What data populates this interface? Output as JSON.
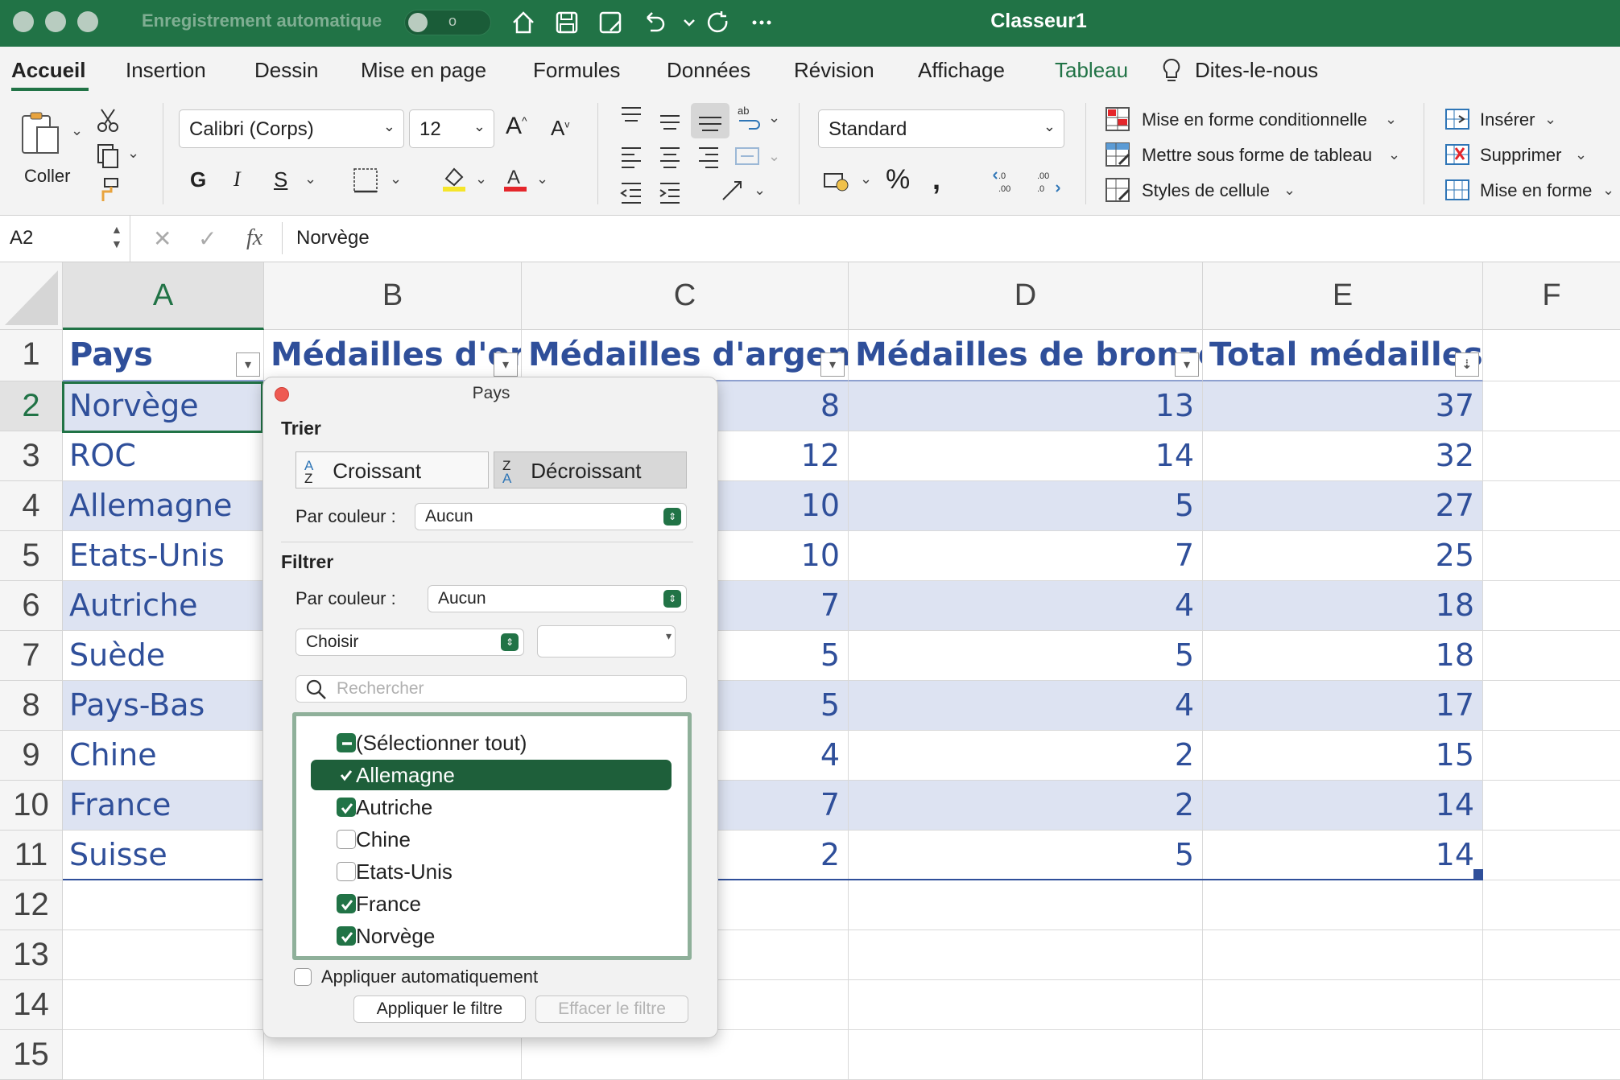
{
  "titlebar": {
    "autosave_label": "Enregistrement automatique",
    "autosave_state": "o",
    "window_title": "Classeur1",
    "icons": [
      "home-icon",
      "save-icon",
      "save-as-icon",
      "undo-icon",
      "chevron-down-icon",
      "redo-icon",
      "more-icon"
    ]
  },
  "tabs": [
    "Accueil",
    "Insertion",
    "Dessin",
    "Mise en page",
    "Formules",
    "Données",
    "Révision",
    "Affichage",
    "Tableau",
    "Dites-le-nous"
  ],
  "ribbon": {
    "paste_label": "Coller",
    "font_name": "Calibri (Corps)",
    "font_size": "12",
    "bold": "G",
    "italic": "I",
    "underline": "S",
    "number_format": "Standard",
    "styles": {
      "conditional": "Mise en forme conditionnelle",
      "table": "Mettre sous forme de tableau",
      "cell": "Styles de cellule"
    },
    "cells": {
      "insert": "Insérer",
      "delete": "Supprimer",
      "format": "Mise en forme"
    }
  },
  "formula_bar": {
    "name_box": "A2",
    "fx": "fx",
    "content": "Norvège"
  },
  "grid": {
    "column_letters": [
      "A",
      "B",
      "C",
      "D",
      "E",
      "F"
    ],
    "row_numbers": [
      "1",
      "2",
      "3",
      "4",
      "5",
      "6",
      "7",
      "8",
      "9",
      "10",
      "11",
      "12",
      "13",
      "14",
      "15"
    ],
    "headers": [
      "Pays",
      "Médailles d'or",
      "Médailles d'argent",
      "Médailles de bronze",
      "Total médailles"
    ],
    "rows": [
      {
        "pays": "Norvège",
        "argent": "8",
        "bronze": "13",
        "total": "37"
      },
      {
        "pays": "ROC",
        "argent": "12",
        "bronze": "14",
        "total": "32"
      },
      {
        "pays": "Allemagne",
        "argent": "10",
        "bronze": "5",
        "total": "27"
      },
      {
        "pays": "Etats-Unis",
        "argent": "10",
        "bronze": "7",
        "total": "25"
      },
      {
        "pays": "Autriche",
        "argent": "7",
        "bronze": "4",
        "total": "18"
      },
      {
        "pays": "Suède",
        "argent": "5",
        "bronze": "5",
        "total": "18"
      },
      {
        "pays": "Pays-Bas",
        "argent": "5",
        "bronze": "4",
        "total": "17"
      },
      {
        "pays": "Chine",
        "argent": "4",
        "bronze": "2",
        "total": "15"
      },
      {
        "pays": "France",
        "argent": "7",
        "bronze": "2",
        "total": "14"
      },
      {
        "pays": "Suisse",
        "argent": "2",
        "bronze": "5",
        "total": "14"
      }
    ]
  },
  "filter_popover": {
    "title": "Pays",
    "sort_section": "Trier",
    "sort_asc": "Croissant",
    "sort_desc": "Décroissant",
    "sort_by_color_label": "Par couleur :",
    "sort_by_color_value": "Aucun",
    "filter_section": "Filtrer",
    "filter_by_color_label": "Par couleur :",
    "filter_by_color_value": "Aucun",
    "choose_value": "Choisir",
    "search_placeholder": "Rechercher",
    "items": [
      {
        "label": "(Sélectionner tout)",
        "state": "mixed"
      },
      {
        "label": "Allemagne",
        "state": "checked",
        "highlighted": true
      },
      {
        "label": "Autriche",
        "state": "checked"
      },
      {
        "label": "Chine",
        "state": "unchecked"
      },
      {
        "label": "Etats-Unis",
        "state": "unchecked"
      },
      {
        "label": "France",
        "state": "checked"
      },
      {
        "label": "Norvège",
        "state": "checked"
      }
    ],
    "auto_apply": "Appliquer automatiquement",
    "apply_button": "Appliquer le filtre",
    "clear_button": "Effacer le filtre"
  },
  "colors": {
    "accent": "#217346",
    "table_text": "#2f4f9a",
    "band": "#dde3f2"
  }
}
